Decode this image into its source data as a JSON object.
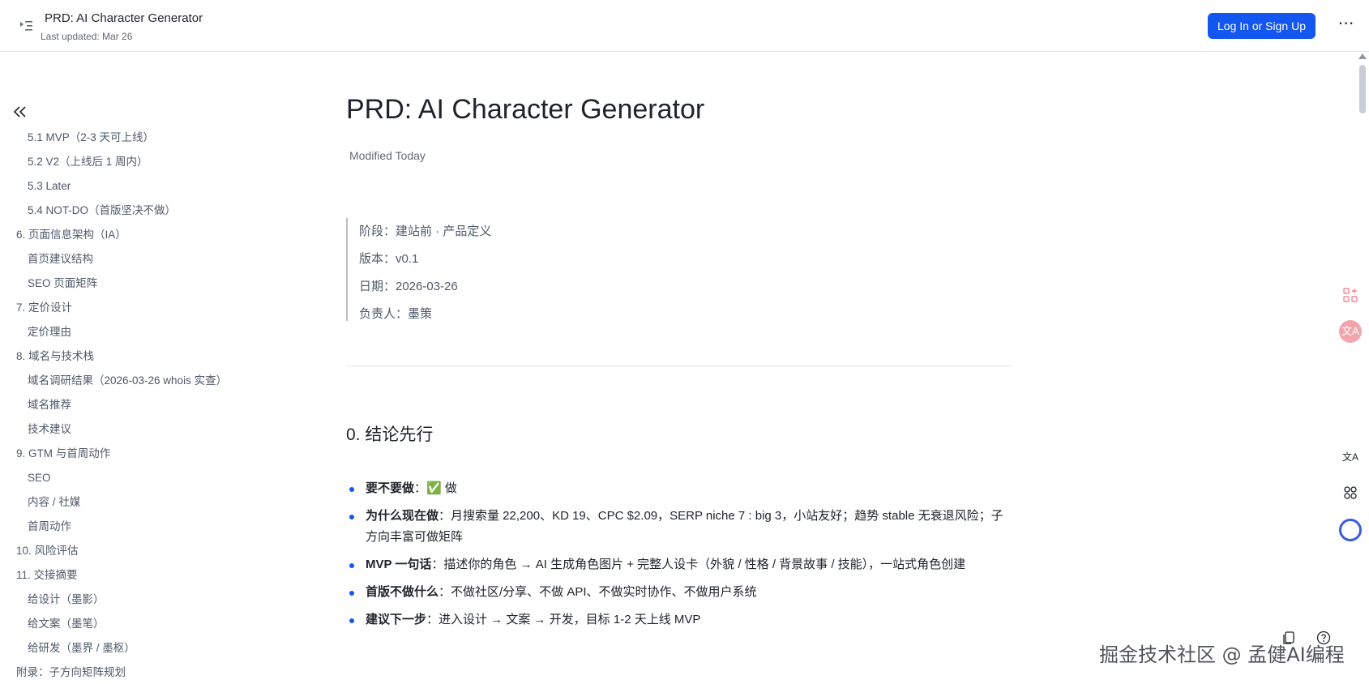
{
  "header": {
    "title": "PRD: AI Character Generator",
    "last_updated": "Last updated: Mar 26",
    "login_label": "Log In or Sign Up",
    "more_label": "⋯"
  },
  "sidebar": {
    "collapse_icon": "double-chevron-left-icon",
    "items": [
      {
        "label": "5.1 MVP（2-3 天可上线）",
        "level": 2
      },
      {
        "label": "5.2 V2（上线后 1 周内）",
        "level": 2
      },
      {
        "label": "5.3 Later",
        "level": 2
      },
      {
        "label": "5.4 NOT-DO（首版坚决不做）",
        "level": 2
      },
      {
        "label": "6. 页面信息架构（IA）",
        "level": 1
      },
      {
        "label": "首页建议结构",
        "level": 2
      },
      {
        "label": "SEO 页面矩阵",
        "level": 2
      },
      {
        "label": "7. 定价设计",
        "level": 1
      },
      {
        "label": "定价理由",
        "level": 2
      },
      {
        "label": "8. 域名与技术栈",
        "level": 1
      },
      {
        "label": "域名调研结果（2026-03-26 whois 实查）",
        "level": 2
      },
      {
        "label": "域名推荐",
        "level": 2
      },
      {
        "label": "技术建议",
        "level": 2
      },
      {
        "label": "9. GTM 与首周动作",
        "level": 1
      },
      {
        "label": "SEO",
        "level": 2
      },
      {
        "label": "内容 / 社媒",
        "level": 2
      },
      {
        "label": "首周动作",
        "level": 2
      },
      {
        "label": "10. 风险评估",
        "level": 1
      },
      {
        "label": "11. 交接摘要",
        "level": 1
      },
      {
        "label": "给设计（墨影）",
        "level": 2
      },
      {
        "label": "给文案（墨笔）",
        "level": 2
      },
      {
        "label": "给研发（墨界 / 墨枢）",
        "level": 2
      },
      {
        "label": "附录：子方向矩阵规划",
        "level": 1
      }
    ]
  },
  "main": {
    "title": "PRD: AI Character Generator",
    "modified": "Modified Today",
    "meta": [
      "阶段：建站前 · 产品定义",
      "版本：v0.1",
      "日期：2026-03-26",
      "负责人：墨策"
    ],
    "section_heading": "0. 结论先行",
    "bullets": [
      {
        "bold": "要不要做",
        "text": "：✅ 做"
      },
      {
        "bold": "为什么现在做",
        "text": "：月搜索量 22,200、KD 19、CPC $2.09，SERP niche 7 : big 3，小站友好；趋势 stable 无衰退风险；子方向丰富可做矩阵"
      },
      {
        "bold": "MVP 一句话",
        "text": "：描述你的角色 → AI 生成角色图片 + 完整人设卡（外貌 / 性格 / 背景故事 / 技能），一站式角色创建"
      },
      {
        "bold": "首版不做什么",
        "text": "：不做社区/分享、不做 API、不做实时协作、不做用户系统"
      },
      {
        "bold": "建议下一步",
        "text": "：进入设计 → 文案 → 开发，目标 1-2 天上线 MVP"
      }
    ]
  },
  "right_rail": {
    "icons": [
      "apps-add-icon",
      "translate-icon",
      "translate-small-icon",
      "grid-icon",
      "ai-assistant-icon"
    ],
    "translate_glyph": "文A",
    "translate_small_glyph": "文A"
  },
  "bottom_right": {
    "icons": [
      "copy-doc-icon",
      "help-icon"
    ],
    "watermark": "掘金技术社区 @ 孟健AI编程"
  },
  "colors": {
    "accent": "#1456f0",
    "text": "#1f2329",
    "muted": "#646a73"
  }
}
